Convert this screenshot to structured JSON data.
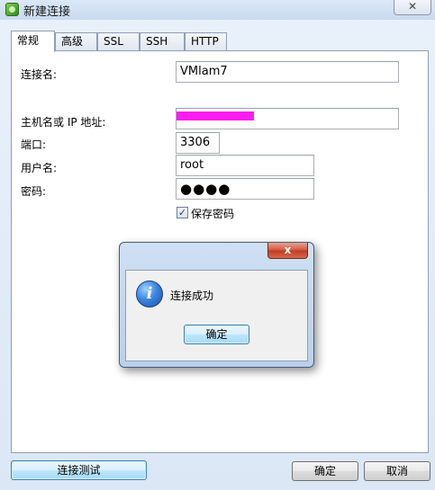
{
  "window": {
    "title": "新建连接",
    "close_glyph": "✕"
  },
  "tabs": [
    {
      "label": "常规",
      "active": true
    },
    {
      "label": "高级",
      "active": false
    },
    {
      "label": "SSL",
      "active": false
    },
    {
      "label": "SSH",
      "active": false
    },
    {
      "label": "HTTP",
      "active": false
    }
  ],
  "form": {
    "connection_name_label": "连接名:",
    "connection_name_value": "VMlam7",
    "host_label": "主机名或 IP 地址:",
    "port_label": "端口:",
    "port_value": "3306",
    "username_label": "用户名:",
    "username_value": "root",
    "password_label": "密码:",
    "password_value": "●●●●",
    "save_password_label": "保存密码",
    "save_password_checked": "✓"
  },
  "buttons": {
    "test_connection": "连接测试",
    "ok": "确定",
    "cancel": "取消"
  },
  "message_box": {
    "close_glyph": "x",
    "text": "连接成功",
    "ok": "确定",
    "icon_glyph": "i"
  },
  "colors": {
    "redaction": "#ff1cf0",
    "focus_border": "#3c7fb1",
    "dialog_close_red": "#c23a20"
  }
}
